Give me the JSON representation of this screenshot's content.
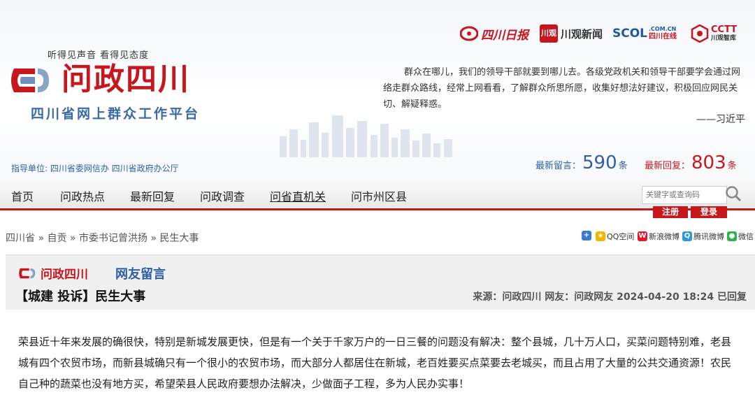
{
  "header": {
    "slogan": "听得见声音  看得见态度",
    "logo_text": "问政四川",
    "logo_subtitle": "四川省网上群众工作平台",
    "guide": "指导单位: 四川省委网信办  四川省政府办公厅",
    "partners": {
      "sichuan_daily": "四川日报",
      "chuanguan_badge": "川观",
      "chuanguan": "川观新闻",
      "scol": "SCOL",
      "scol_domain": ".COM.CN",
      "scol_cn": "四川在线",
      "cctt": "CCTT",
      "cctt_cn": "川观智库"
    },
    "quote": "群众在哪儿，我们的领导干部就要到哪儿去。各级党政机关和领导干部要学会通过网络走群众路线，经常上网看看，了解群众所思所愿，收集好想法好建议，积极回应网民关切、解疑释惑。",
    "quote_author": "——习近平",
    "stats": {
      "latest_msg_label": "最新留言：",
      "latest_msg_count": "590",
      "latest_msg_unit": "条",
      "latest_reply_label": "最新回复：",
      "latest_reply_count": "803",
      "latest_reply_unit": "条"
    }
  },
  "nav": {
    "items": [
      "首页",
      "问政热点",
      "最新回复",
      "问政调查",
      "问省直机关",
      "问市州区县"
    ],
    "search_placeholder": "关键字或查询码",
    "register": "注册",
    "login": "登录"
  },
  "breadcrumb": "四川省 » 自贡 » 市委书记曾洪扬 » 民生大事",
  "share": {
    "plus": "+",
    "qq": "QQ空间",
    "weibo": "新浪微博",
    "tencent": "腾讯微博",
    "wechat": "微信"
  },
  "post": {
    "logo_text": "问政四川",
    "section": "网友留言",
    "title": "【城建 投诉】民生大事",
    "meta": "来源：问政四川 网友：问政网友  2024-04-20 18:24 已回复",
    "body": "荣县近十年来发展的确很快，特别是新城发展更快，但是有一个关于千家万户的一日三餐的问题没有解决：整个县城，几十万人口，买菜问题特别难，老县城有四个农贸市场，而新县城确只有一个很小的农贸市场，而大部分人都居住在新城，老百姓要买点菜要去老城买，而且占用了大量的公共交通资源！农民自己种的蔬菜也没有地方买，希望荣县人民政府要想办法解决，少做面子工程，多为人民办实事！"
  },
  "colors": {
    "brand_red": "#c8161d",
    "brand_blue": "#2d5fa5"
  }
}
